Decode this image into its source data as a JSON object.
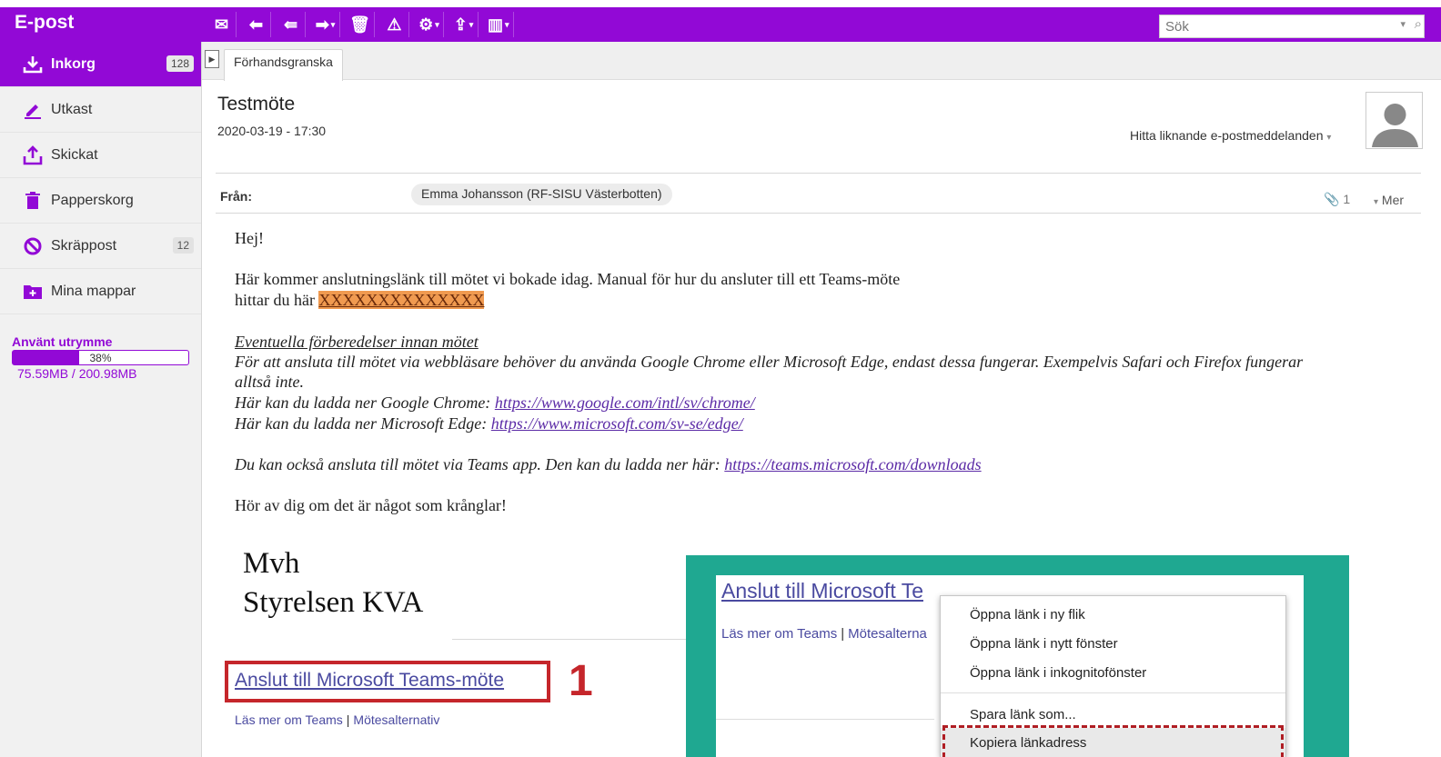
{
  "app": {
    "title": "E-post"
  },
  "toolbar": {
    "buttons": [
      {
        "name": "new-mail-icon",
        "glyph": "✉"
      },
      {
        "name": "reply-icon",
        "glyph": "⬅"
      },
      {
        "name": "reply-all-icon",
        "glyph": "⇚"
      },
      {
        "name": "forward-icon",
        "glyph": "➡"
      },
      {
        "name": "delete-icon",
        "glyph": "🗑"
      },
      {
        "name": "warning-icon",
        "glyph": "⚠"
      },
      {
        "name": "settings-icon",
        "glyph": "⚙"
      },
      {
        "name": "move-icon",
        "glyph": "⇪"
      },
      {
        "name": "layout-icon",
        "glyph": "▥"
      }
    ]
  },
  "search": {
    "placeholder": "Sök"
  },
  "sidebar": {
    "items": [
      {
        "label": "Inkorg",
        "icon": "inbox-download-icon",
        "badge": "128",
        "active": true
      },
      {
        "label": "Utkast",
        "icon": "pencil-icon",
        "badge": ""
      },
      {
        "label": "Skickat",
        "icon": "upload-icon",
        "badge": ""
      },
      {
        "label": "Papperskorg",
        "icon": "trash-icon",
        "badge": ""
      },
      {
        "label": "Skräppost",
        "icon": "block-icon",
        "badge": "12"
      },
      {
        "label": "Mina mappar",
        "icon": "folder-add-icon",
        "badge": ""
      }
    ],
    "quota": {
      "label": "Använt utrymme",
      "percent_text": "38%",
      "percent": 0.38,
      "usage": "75.59MB / 200.98MB"
    }
  },
  "tabs": {
    "preview": "Förhandsgranska"
  },
  "message": {
    "subject": "Testmöte",
    "date": "2020-03-19 - 17:30",
    "find_similar": "Hitta liknande e-postmeddelanden",
    "from_label": "Från:",
    "sender": "Emma Johansson (RF-SISU Västerbotten)",
    "attachment_count": "1",
    "more_label": "Mer",
    "body": {
      "greeting": "Hej!",
      "p1_line1": "Här kommer anslutningslänk till mötet vi bokade idag. Manual för hur du ansluter till ett Teams-möte",
      "p1_line2_prefix": "hittar du här ",
      "p1_placeholder": "XXXXXXXXXXXXXX",
      "prep_heading": "Eventuella förberedelser innan mötet",
      "prep_line1": "För att ansluta till mötet via webbläsare behöver du använda Google Chrome eller Microsoft Edge, endast dessa fungerar. Exempelvis Safari och Firefox fungerar",
      "prep_line2": "alltså inte.",
      "chrome_prefix": "Här kan du ladda ner Google Chrome: ",
      "chrome_url": "https://www.google.com/intl/sv/chrome/",
      "edge_prefix": "Här kan du ladda ner Microsoft Edge: ",
      "edge_url": "https://www.microsoft.com/sv-se/edge/",
      "teams_prefix": "Du kan också ansluta till mötet via Teams app. Den kan du ladda ner här: ",
      "teams_url": "https://teams.microsoft.com/downloads",
      "closing": "Hör av dig om det är något som krånglar!",
      "sig1": "Mvh",
      "sig2": "Styrelsen KVA",
      "join_link": "Anslut till Microsoft Teams-möte",
      "learn_more": "Läs mer om Teams",
      "meeting_options": "Mötesalternativ",
      "step_number": "1"
    }
  },
  "inset": {
    "join_link": "Anslut till Microsoft Te",
    "learn_more": "Läs mer om Teams",
    "meeting_options_partial": "Mötesalterna",
    "context_menu": [
      "Öppna länk i ny flik",
      "Öppna länk i nytt fönster",
      "Öppna länk i inkognitofönster",
      "Spara länk som...",
      "Kopiera länkadress"
    ]
  },
  "colors": {
    "brand": "#9209d6",
    "annotation_red": "#c5262b",
    "highlight": "#f09a50",
    "inset_bg": "#1fa891"
  }
}
